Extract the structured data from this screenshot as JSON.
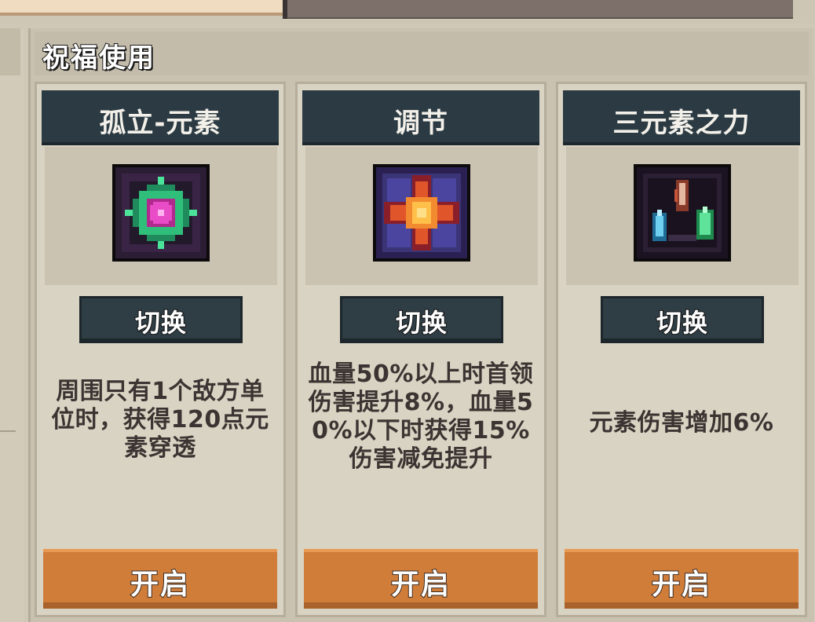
{
  "header": {
    "title": "祝福使用"
  },
  "cards": [
    {
      "title": "孤立-元素",
      "icon": "green-pink-gem-icon",
      "switch_label": "切换",
      "description_lines": [
        "周围只有1个敌方单",
        "位时，获得120点元",
        "素穿透"
      ],
      "open_label": "开启"
    },
    {
      "title": "调节",
      "icon": "orange-star-cross-icon",
      "switch_label": "切换",
      "description_lines": [
        "血量50%以上时首领",
        "伤害提升8%，血量5",
        "0%以下时获得15%",
        "伤害减免提升"
      ],
      "open_label": "开启"
    },
    {
      "title": "三元素之力",
      "icon": "three-crystals-icon",
      "switch_label": "切换",
      "description_lines": [
        "元素伤害增加6%"
      ],
      "open_label": "开启"
    }
  ],
  "colors": {
    "card_header": "#2c3b43",
    "open_button": "#d07d3a",
    "text_dark": "#3b3432"
  }
}
